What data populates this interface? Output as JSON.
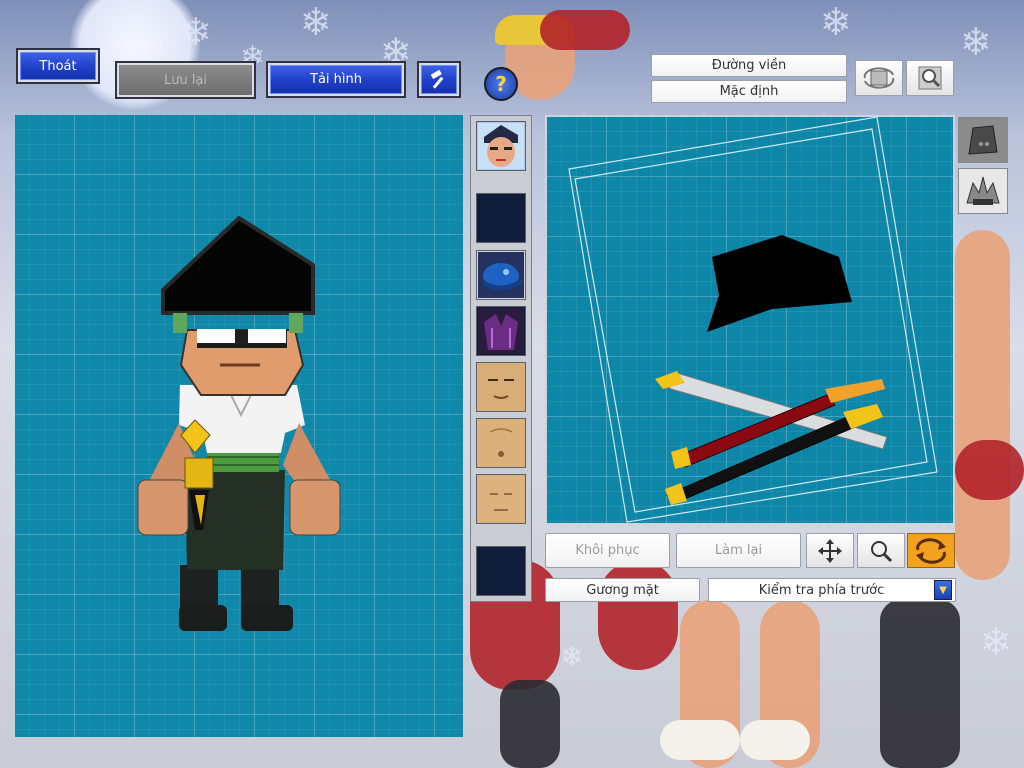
{
  "top_bar": {
    "exit_label": "Thoát",
    "save_label": "Lưu lại",
    "reload_label": "Tải hình",
    "tool_icon": "hammer-icon",
    "help_icon": "question-icon"
  },
  "right_top": {
    "outline_label": "Đường viền",
    "default_label": "Mặc định",
    "rotate_icon": "rotate-view-icon",
    "zoom_icon": "magnify-icon"
  },
  "slots": [
    {
      "name": "portrait",
      "icon": "face-portrait-icon"
    },
    {
      "name": "empty-1",
      "icon": ""
    },
    {
      "name": "helmet",
      "icon": "blue-helmet-icon"
    },
    {
      "name": "armor",
      "icon": "purple-armor-icon"
    },
    {
      "name": "face-1",
      "icon": "face-shape-icon"
    },
    {
      "name": "face-2",
      "icon": "face-shape-icon"
    },
    {
      "name": "face-3",
      "icon": "face-shape-icon"
    },
    {
      "name": "empty-2",
      "icon": ""
    }
  ],
  "side_slots": [
    {
      "icon": "rock-icon"
    },
    {
      "icon": "spiky-hat-icon"
    }
  ],
  "editor_controls": {
    "restore_label": "Khôi phục",
    "redo_label": "Làm lại",
    "move_icon": "move-arrows-icon",
    "zoom_icon": "magnify-icon",
    "swap_icon": "swap-rotate-icon",
    "face_label": "Gương mặt",
    "view_select": "Kiểm tra phía trước"
  },
  "colors": {
    "panel_bg": "#0e86a8",
    "button_blue": "#1f3fc9",
    "accent_orange": "#f29a1c"
  }
}
